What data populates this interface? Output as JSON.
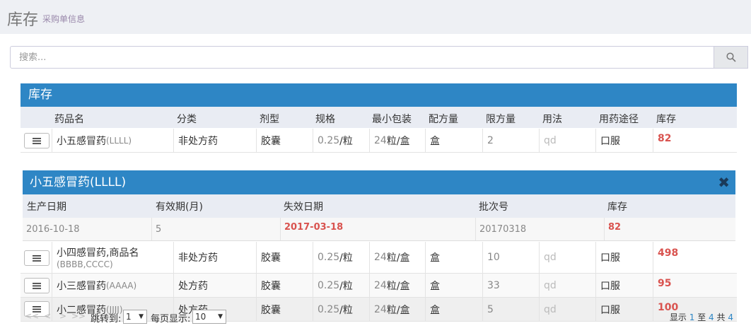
{
  "header": {
    "title": "库存",
    "subtitle": "采购单信息"
  },
  "search": {
    "placeholder": "搜索..."
  },
  "panel": {
    "title": "库存"
  },
  "columns": [
    "药品名",
    "分类",
    "剂型",
    "规格",
    "最小包装",
    "配方量",
    "限方量",
    "用法",
    "用药途径",
    "库存"
  ],
  "rows": [
    {
      "name": "小五感冒药",
      "name_sub": "(LLLL)",
      "category": "非处方药",
      "form": "胶囊",
      "spec_num": "0.25",
      "spec_unit": "/粒",
      "pack_num": "24",
      "pack_unit": "粒/盒",
      "formula": "盒",
      "limit": "2",
      "usage": "qd",
      "route": "口服",
      "stock": "82"
    },
    {
      "name": "小四感冒药,商品名",
      "name_sub": "(BBBB,CCCC)",
      "category": "非处方药",
      "form": "胶囊",
      "spec_num": "0.25",
      "spec_unit": "/粒",
      "pack_num": "24",
      "pack_unit": "粒/盒",
      "formula": "盒",
      "limit": "10",
      "usage": "qd",
      "route": "口服",
      "stock": "498"
    },
    {
      "name": "小三感冒药",
      "name_sub": "(AAAA)",
      "category": "处方药",
      "form": "胶囊",
      "spec_num": "0.25",
      "spec_unit": "/粒",
      "pack_num": "24",
      "pack_unit": "粒/盒",
      "formula": "盒",
      "limit": "33",
      "usage": "qd",
      "route": "口服",
      "stock": "95"
    },
    {
      "name": "小二感冒药",
      "name_sub": "(JJJJ)",
      "category": "处方药",
      "form": "胶囊",
      "spec_num": "0.25",
      "spec_unit": "/粒",
      "pack_num": "24",
      "pack_unit": "粒/盒",
      "formula": "盒",
      "limit": "5",
      "usage": "qd",
      "route": "口服",
      "stock": "100"
    }
  ],
  "detail": {
    "title": "小五感冒药(LLLL)",
    "columns": [
      "生产日期",
      "有效期(月)",
      "失效日期",
      "批次号",
      "库存"
    ],
    "row": {
      "production_date": "2016-10-18",
      "validity_months": "5",
      "expiry_date": "2017-03-18",
      "batch": "20170318",
      "stock": "82"
    }
  },
  "pager": {
    "arrows": [
      "<<",
      "<",
      ">",
      ">>"
    ],
    "jump_label": "跳转到:",
    "jump_value": "1",
    "per_page_label": "每页显示:",
    "per_page_value": "10",
    "summary_prefix": "显示",
    "from": "1",
    "to_label": "至",
    "to": "4",
    "total_label": "共",
    "total": "4"
  },
  "colors": {
    "accent": "#2e86c5",
    "stock_red": "#d9534f",
    "header_bg": "#e9ecf3"
  },
  "icons": {
    "search": "search-icon",
    "menu": "menu-icon",
    "close": "close-icon"
  }
}
